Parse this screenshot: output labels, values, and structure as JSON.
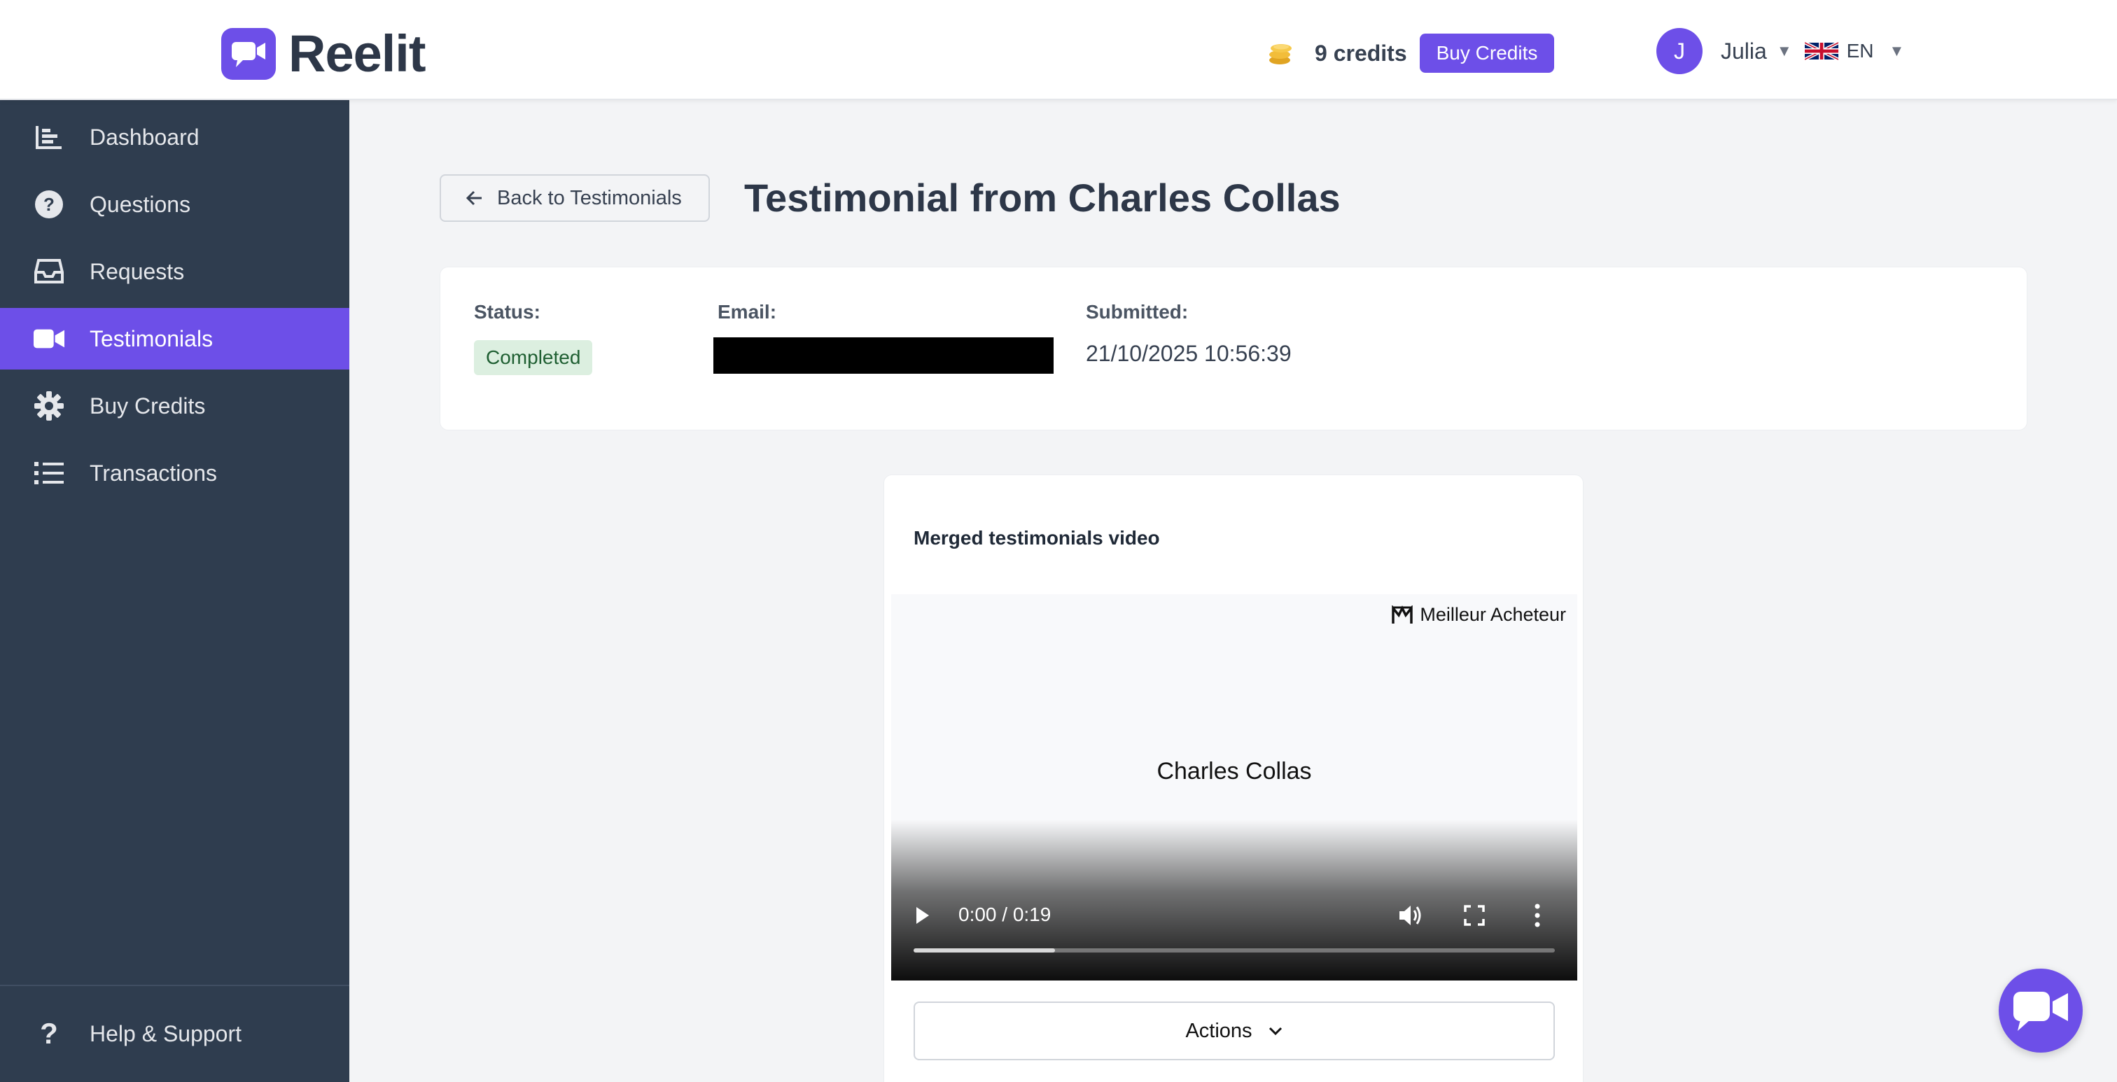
{
  "brand": {
    "name": "Reelit",
    "accent": "#6d4fe8"
  },
  "header": {
    "credits_label": "9 credits",
    "buy_credits_label": "Buy Credits",
    "user_initial": "J",
    "user_name": "Julia",
    "language": "EN"
  },
  "sidebar": {
    "items": [
      {
        "label": "Dashboard",
        "icon": "bar-chart-icon"
      },
      {
        "label": "Questions",
        "icon": "question-circle-icon"
      },
      {
        "label": "Requests",
        "icon": "inbox-icon"
      },
      {
        "label": "Testimonials",
        "icon": "video-camera-icon",
        "active": true
      },
      {
        "label": "Buy Credits",
        "icon": "gear-icon"
      },
      {
        "label": "Transactions",
        "icon": "list-icon"
      }
    ],
    "help_label": "Help & Support"
  },
  "main": {
    "back_label": "Back to Testimonials",
    "title": "Testimonial from Charles Collas",
    "info": {
      "status_label": "Status:",
      "status_value": "Completed",
      "email_label": "Email:",
      "submitted_label": "Submitted:",
      "submitted_value": "21/10/2025 10:56:39"
    },
    "video_card": {
      "title": "Merged testimonials video",
      "brand_overlay": "Meilleur Acheteur",
      "person_name": "Charles Collas",
      "time": "0:00 / 0:19",
      "buffered_fraction": 0.22,
      "actions_label": "Actions"
    }
  }
}
